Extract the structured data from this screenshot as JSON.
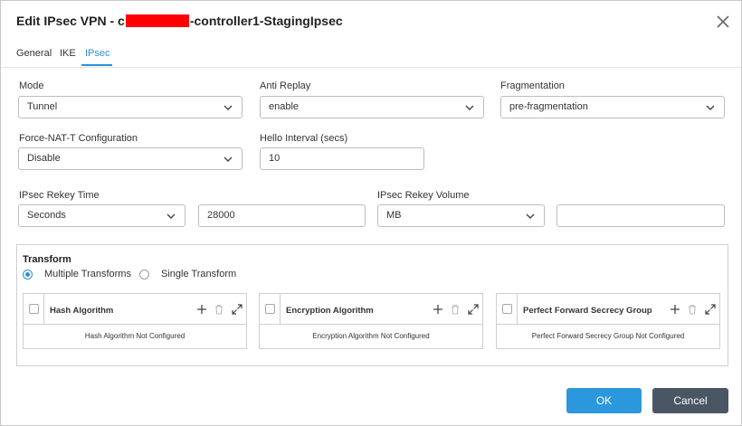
{
  "dialog": {
    "title_prefix": "Edit IPsec VPN - c",
    "title_suffix": "-controller1-StagingIpsec"
  },
  "tabs": [
    {
      "label": "General"
    },
    {
      "label": "IKE"
    },
    {
      "label": "IPsec"
    }
  ],
  "fields": {
    "mode": {
      "label": "Mode",
      "value": "Tunnel"
    },
    "anti_replay": {
      "label": "Anti Replay",
      "value": "enable"
    },
    "fragmentation": {
      "label": "Fragmentation",
      "value": "pre-fragmentation"
    },
    "force_nat_t": {
      "label": "Force-NAT-T Configuration",
      "value": "Disable"
    },
    "hello_interval": {
      "label": "Hello Interval (secs)",
      "value": "10"
    },
    "rekey_time": {
      "label": "IPsec Rekey Time",
      "unit": "Seconds",
      "value": "28000"
    },
    "rekey_volume": {
      "label": "IPsec Rekey Volume",
      "unit": "MB",
      "value": ""
    }
  },
  "transform": {
    "title": "Transform",
    "options": [
      "Multiple Transforms",
      "Single Transform"
    ],
    "selected": "Multiple Transforms",
    "panels": [
      {
        "title": "Hash Algorithm",
        "empty": "Hash Algorithm Not Configured"
      },
      {
        "title": "Encryption Algorithm",
        "empty": "Encryption Algorithm Not Configured"
      },
      {
        "title": "Perfect Forward Secrecy Group",
        "empty": "Perfect Forward Secrecy Group Not Configured"
      }
    ]
  },
  "buttons": {
    "ok": "OK",
    "cancel": "Cancel"
  },
  "colors": {
    "accent": "#2b97dd",
    "cancel": "#4a5663",
    "redaction": "#ff0000"
  }
}
